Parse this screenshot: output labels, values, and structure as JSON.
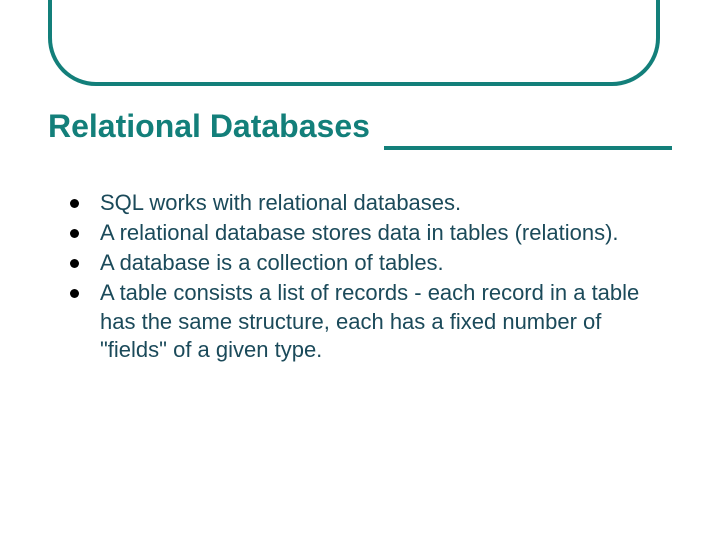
{
  "slide": {
    "title": "Relational Databases",
    "bullets": [
      "SQL works with relational databases.",
      " A relational database stores data in tables (relations).",
      "A database is a collection of tables.",
      "A table consists a list of records - each record in a table has the same structure, each has a fixed number of \"fields\" of a given type."
    ]
  }
}
